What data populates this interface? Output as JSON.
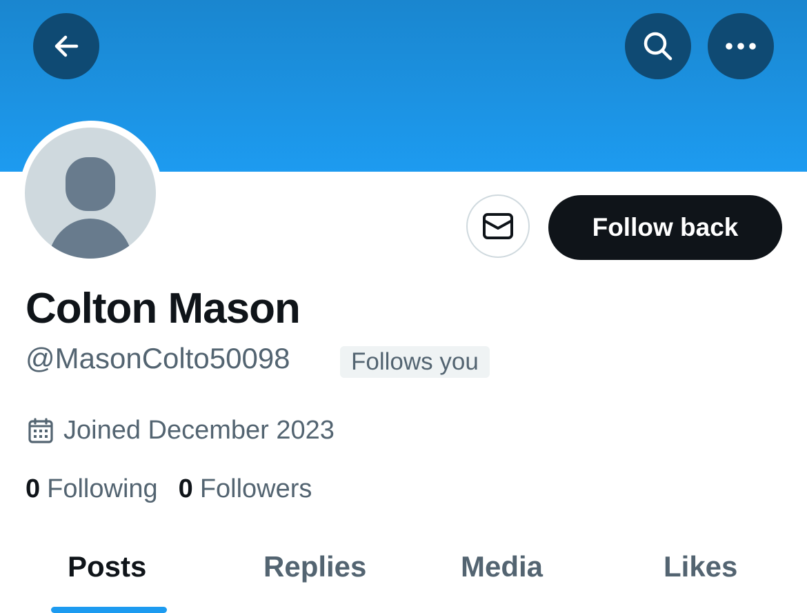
{
  "header": {
    "back_icon": "arrow-left-icon",
    "search_icon": "search-icon",
    "more_icon": "ellipsis-icon",
    "banner_color": "#1d9bf0"
  },
  "profile": {
    "name": "Colton Mason",
    "handle": "@MasonColto50098",
    "follows_you": "Follows you",
    "joined": "Joined December 2023",
    "following_count": "0",
    "following_label": "Following",
    "followers_count": "0",
    "followers_label": "Followers"
  },
  "actions": {
    "message_icon": "envelope-icon",
    "follow_back_label": "Follow back"
  },
  "tabs": [
    {
      "label": "Posts",
      "active": true
    },
    {
      "label": "Replies",
      "active": false
    },
    {
      "label": "Media",
      "active": false
    },
    {
      "label": "Likes",
      "active": false
    }
  ],
  "colors": {
    "accent": "#1d9bf0",
    "text_primary": "#0f1419",
    "text_secondary": "#536471"
  }
}
